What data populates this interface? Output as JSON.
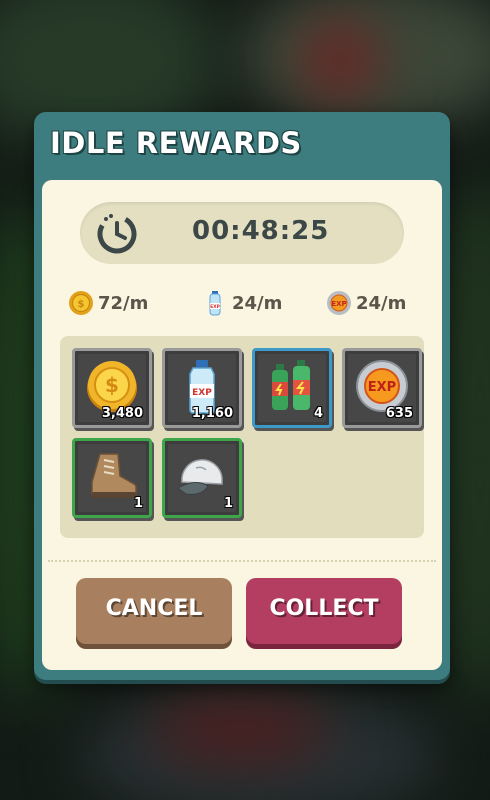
{
  "dialog": {
    "title": "IDLE REWARDS",
    "timer": {
      "icon": "stopwatch-icon",
      "value": "00:48:25"
    },
    "rates": [
      {
        "icon": "gold-coin-icon",
        "label": "72/m"
      },
      {
        "icon": "exp-water-bottle-icon",
        "label": "24/m"
      },
      {
        "icon": "exp-token-icon",
        "label": "24/m"
      }
    ],
    "rewards": [
      {
        "icon": "gold-coin-icon",
        "quantity": "3,480",
        "rarity": "gray"
      },
      {
        "icon": "exp-water-bottle-icon",
        "quantity": "1,160",
        "rarity": "gray"
      },
      {
        "icon": "energy-drink-bottles-icon",
        "quantity": "4",
        "rarity": "blue"
      },
      {
        "icon": "exp-token-icon",
        "quantity": "635",
        "rarity": "gray"
      },
      {
        "icon": "hiking-boot-icon",
        "quantity": "1",
        "rarity": "green"
      },
      {
        "icon": "cap-icon",
        "quantity": "1",
        "rarity": "green"
      }
    ],
    "buttons": {
      "cancel": "CANCEL",
      "collect": "COLLECT"
    }
  },
  "colors": {
    "frame": "#3d7d7f",
    "panel": "#fbf6e2",
    "cancel_button": "#a8805f",
    "collect_button": "#b43d62",
    "rarity_gray": "#9a9a9a",
    "rarity_blue": "#3d99c8",
    "rarity_green": "#3ea54a"
  }
}
